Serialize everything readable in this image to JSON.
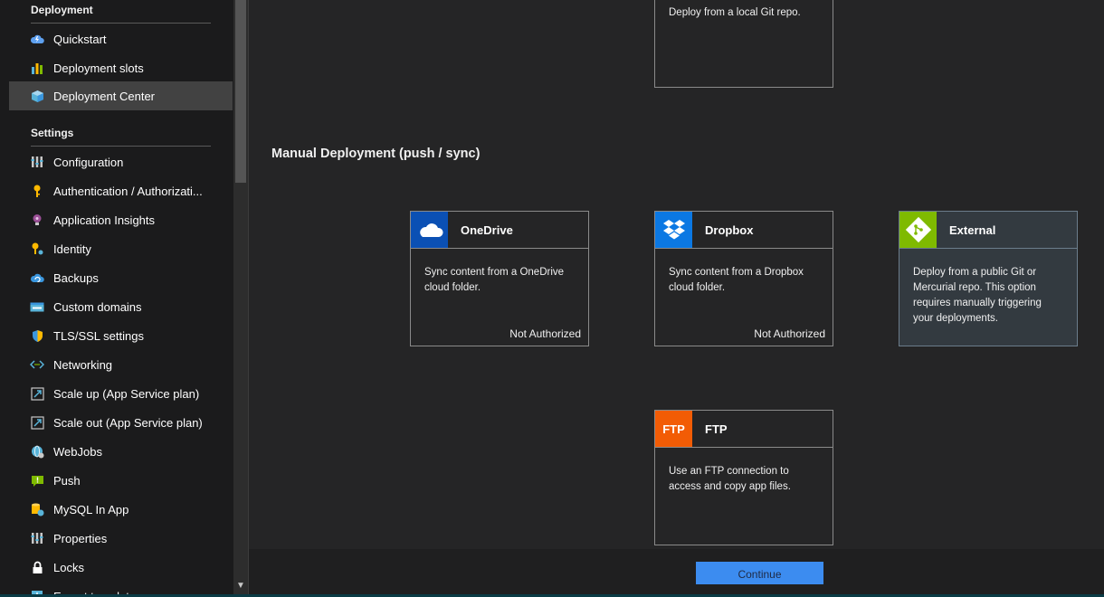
{
  "sidebar": {
    "sections": [
      {
        "title": "Deployment"
      },
      {
        "title": "Settings"
      }
    ],
    "items": [
      {
        "label": "Quickstart",
        "icon": "cloud-bolt-icon"
      },
      {
        "label": "Deployment slots",
        "icon": "bar-chart-icon"
      },
      {
        "label": "Deployment Center",
        "icon": "cube-icon",
        "active": true
      },
      {
        "label": "Configuration",
        "icon": "sliders-icon"
      },
      {
        "label": "Authentication / Authorizati...",
        "icon": "key-icon"
      },
      {
        "label": "Application Insights",
        "icon": "lightbulb-icon"
      },
      {
        "label": "Identity",
        "icon": "identity-key-icon"
      },
      {
        "label": "Backups",
        "icon": "backup-cloud-icon"
      },
      {
        "label": "Custom domains",
        "icon": "www-icon"
      },
      {
        "label": "TLS/SSL settings",
        "icon": "shield-icon"
      },
      {
        "label": "Networking",
        "icon": "network-arrows-icon"
      },
      {
        "label": "Scale up (App Service plan)",
        "icon": "scale-up-icon"
      },
      {
        "label": "Scale out (App Service plan)",
        "icon": "scale-out-icon"
      },
      {
        "label": "WebJobs",
        "icon": "webjobs-globe-icon"
      },
      {
        "label": "Push",
        "icon": "push-icon"
      },
      {
        "label": "MySQL In App",
        "icon": "database-icon"
      },
      {
        "label": "Properties",
        "icon": "properties-icon"
      },
      {
        "label": "Locks",
        "icon": "lock-icon"
      },
      {
        "label": "Export template",
        "icon": "export-icon"
      }
    ]
  },
  "main": {
    "local_git": {
      "description": "Deploy from a local Git repo."
    },
    "manual_title": "Manual Deployment (push / sync)",
    "cards": {
      "onedrive": {
        "title": "OneDrive",
        "description": "Sync content from a OneDrive cloud folder.",
        "status": "Not Authorized",
        "logo_color": "#0b50b4"
      },
      "dropbox": {
        "title": "Dropbox",
        "description": "Sync content from a Dropbox cloud folder.",
        "status": "Not Authorized",
        "logo_color": "#0b78e3"
      },
      "external": {
        "title": "External",
        "description": "Deploy from a public Git or Mercurial repo. This option requires manually triggering your deployments.",
        "logo_color": "#7fba00"
      },
      "ftp": {
        "title": "FTP",
        "logo_text": "FTP",
        "description": "Use an FTP connection to access and copy app files.",
        "logo_color": "#f25c05"
      }
    },
    "continue_label": "Continue"
  }
}
